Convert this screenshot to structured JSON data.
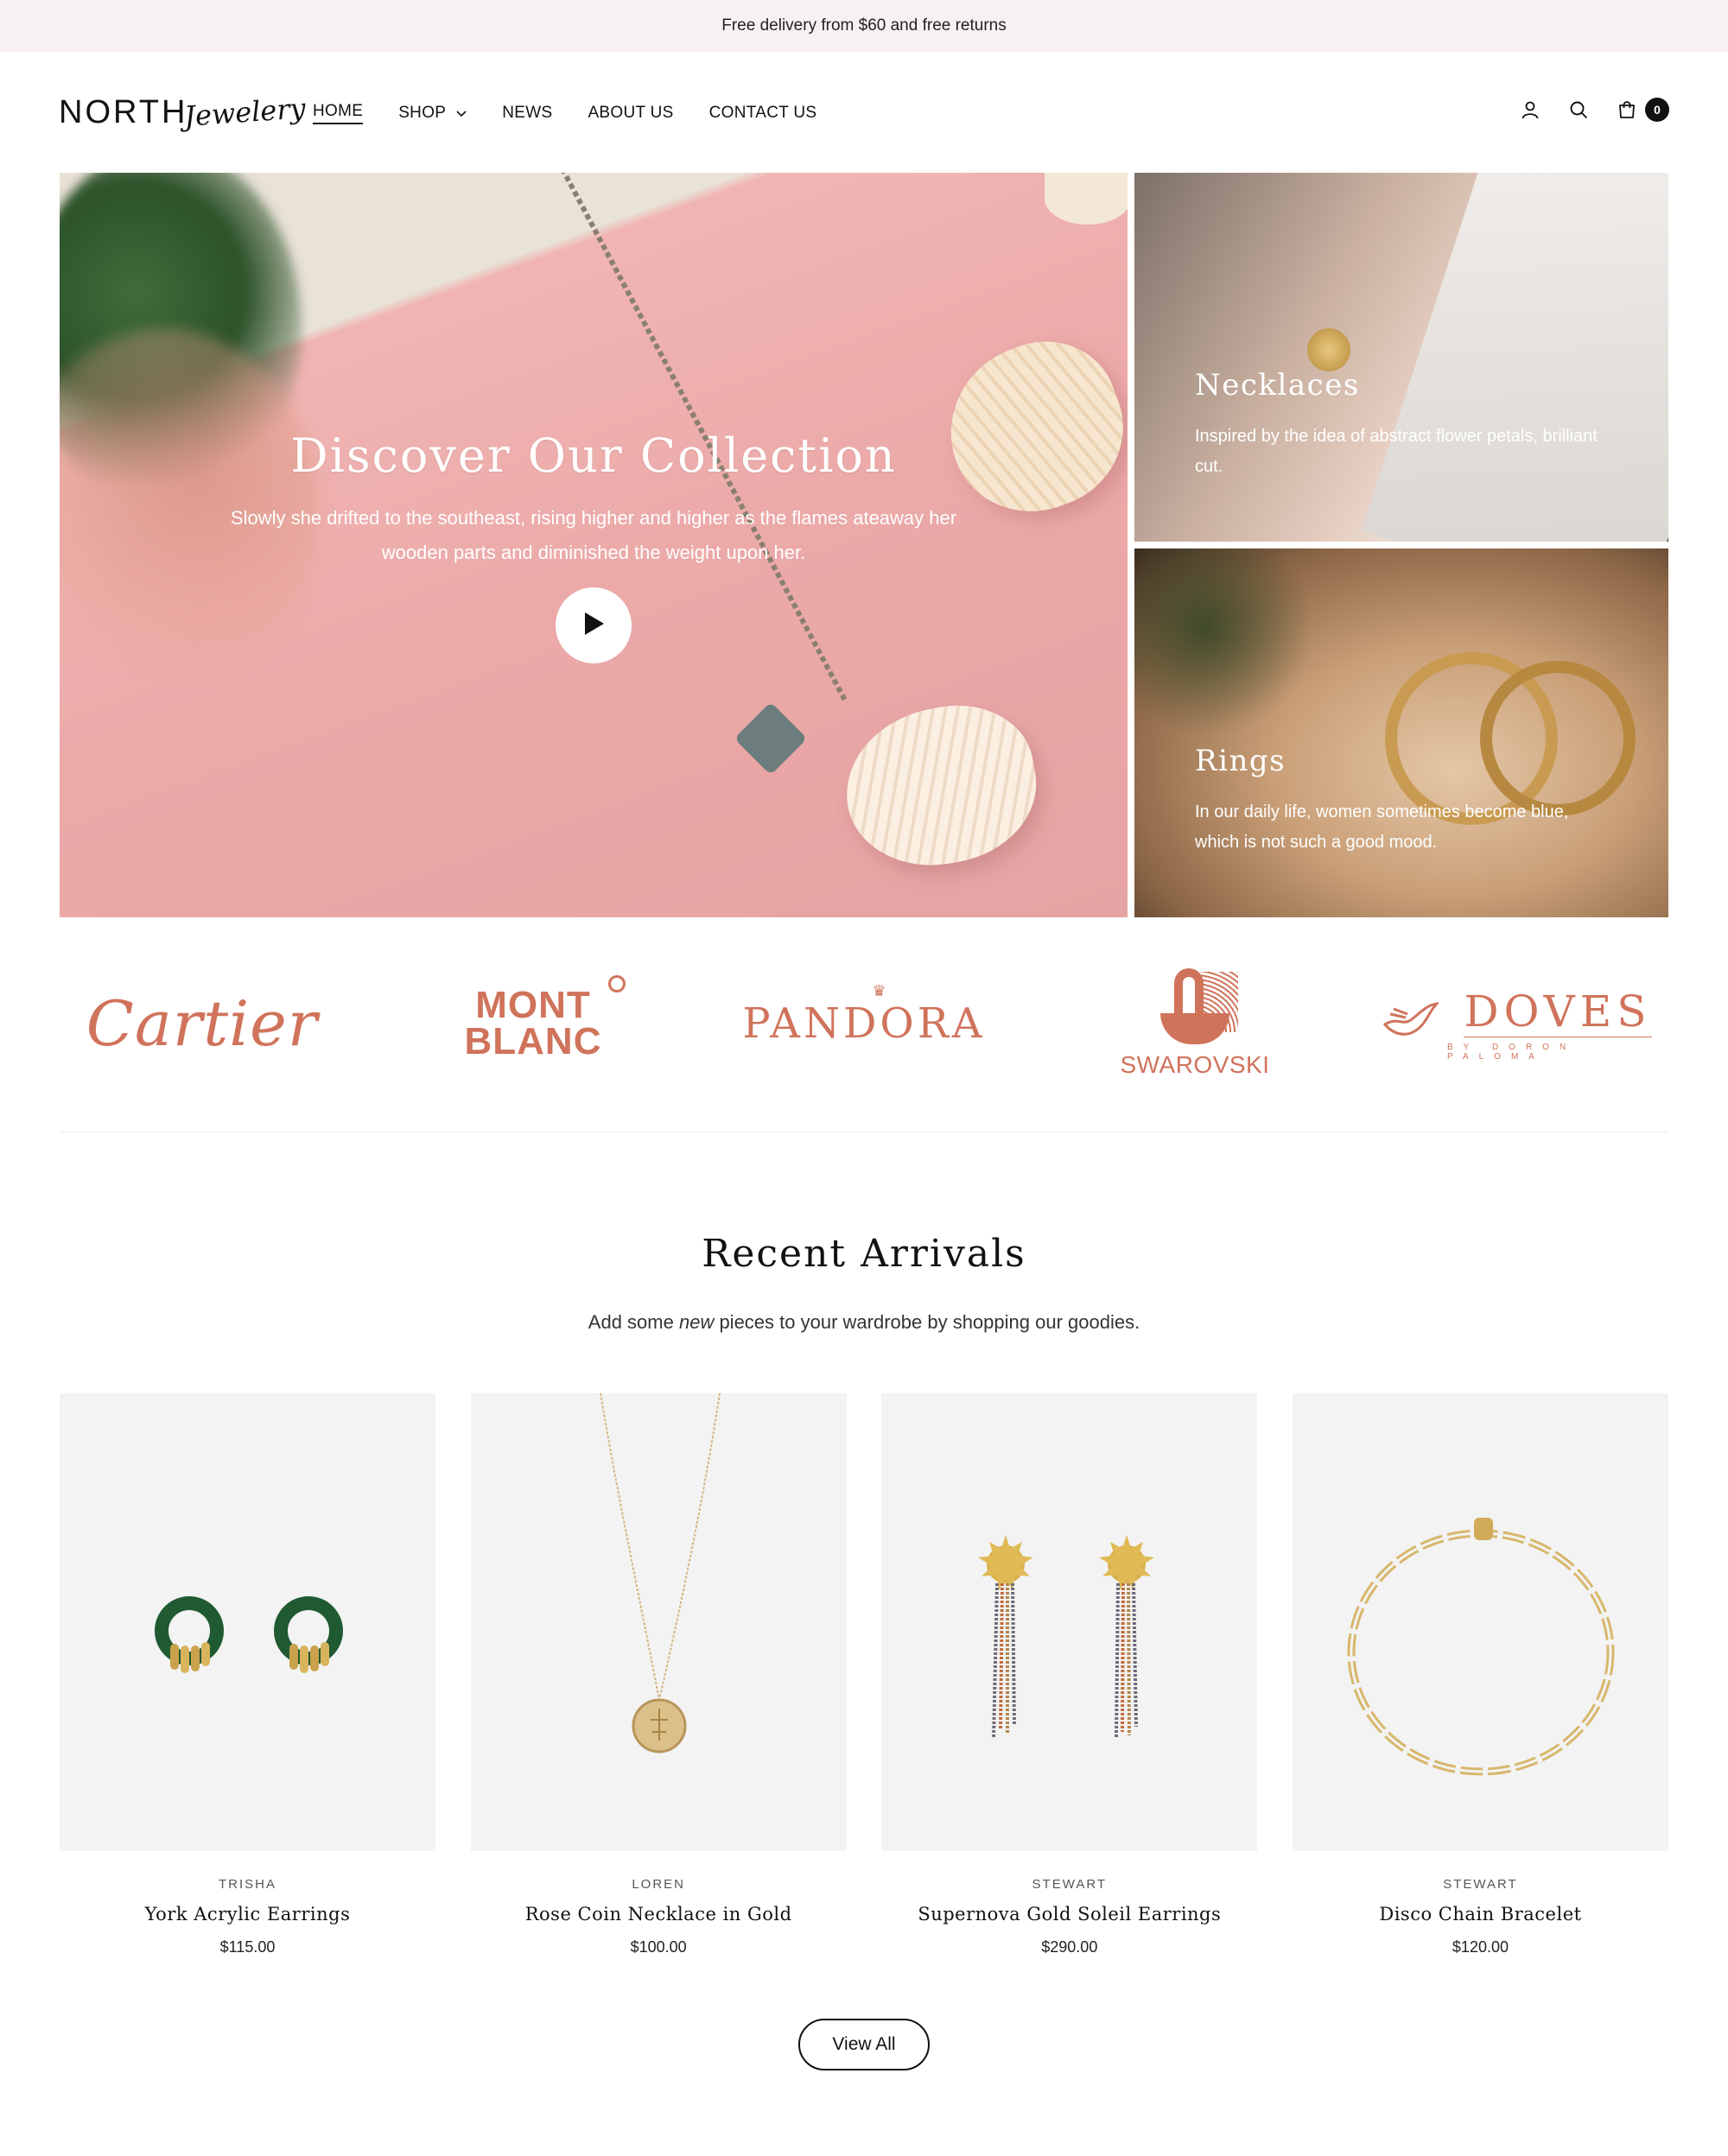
{
  "announcement": "Free delivery from $60 and free returns",
  "logo": {
    "primary": "NORTH",
    "script": "Jewelery"
  },
  "nav": {
    "items": [
      {
        "label": "HOME",
        "active": true
      },
      {
        "label": "SHOP",
        "has_dropdown": true
      },
      {
        "label": "NEWS"
      },
      {
        "label": "ABOUT US"
      },
      {
        "label": "CONTACT US"
      }
    ]
  },
  "header_icons": [
    "user-icon",
    "search-icon",
    "cart-icon"
  ],
  "cart": {
    "count": "0"
  },
  "hero": {
    "title": "Discover Our Collection",
    "subtitle": "Slowly she drifted to the southeast, rising higher and higher as the flames ateaway her wooden parts and diminished the weight upon her.",
    "play_icon": "play-icon"
  },
  "tiles": [
    {
      "title": "Necklaces",
      "text": "Inspired by the idea of abstract flower petals, brilliant cut."
    },
    {
      "title": "Rings",
      "text": "In our daily life, women sometimes become blue, which is not such a good mood."
    }
  ],
  "brands": {
    "color": "#d0735b",
    "items": [
      {
        "name": "Cartier"
      },
      {
        "name": "MONT BLANC",
        "line1": "MONT",
        "line2": "BLANC"
      },
      {
        "name": "PANDORA"
      },
      {
        "name": "SWAROVSKI"
      },
      {
        "name": "DOVES",
        "sub": "BY DORON PALOMA"
      }
    ]
  },
  "recent": {
    "title": "Recent Arrivals",
    "subtitle_before": "Add some ",
    "subtitle_em": "new",
    "subtitle_after": " pieces to your wardrobe by shopping our goodies."
  },
  "products": [
    {
      "vendor": "TRISHA",
      "name": "York Acrylic Earrings",
      "price": "$115.00"
    },
    {
      "vendor": "LOREN",
      "name": "Rose Coin Necklace in Gold",
      "price": "$100.00"
    },
    {
      "vendor": "STEWART",
      "name": "Supernova Gold Soleil Earrings",
      "price": "$290.00"
    },
    {
      "vendor": "STEWART",
      "name": "Disco Chain Bracelet",
      "price": "$120.00"
    }
  ],
  "view_all": "View All"
}
